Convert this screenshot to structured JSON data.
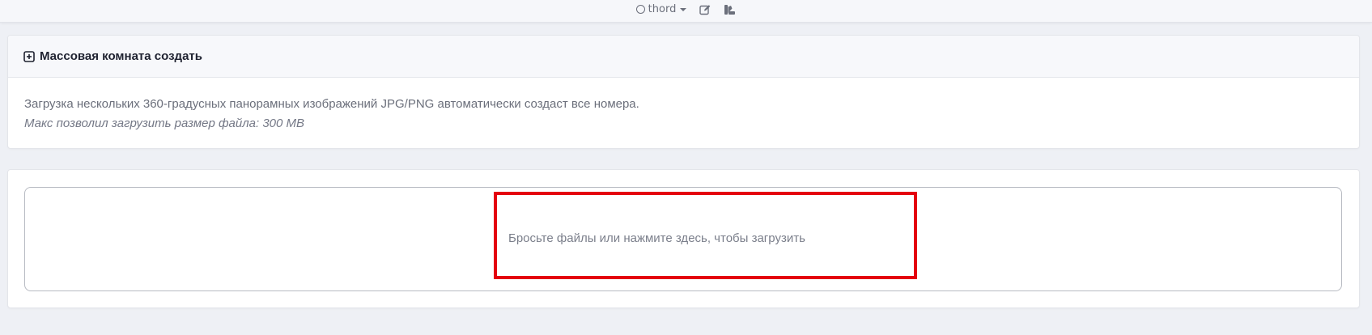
{
  "header": {
    "username": "thord",
    "icons": [
      "circle-status-icon",
      "caret-down-icon",
      "edit-icon",
      "palette-icon"
    ]
  },
  "bulk_create": {
    "title": "Массовая комната создать",
    "description": "Загрузка нескольких 360-градусных панорамных изображений JPG/PNG автоматически создаст все номера.",
    "note": "Макс позволил загрузить размер файла: 300 MB"
  },
  "dropzone": {
    "message": "Бросьте файлы или нажмите здесь, чтобы загрузить"
  },
  "colors": {
    "highlight": "#e4000f",
    "page_bg": "#eef0f5",
    "card_bg": "#ffffff",
    "text_muted": "#6b6f7b"
  }
}
